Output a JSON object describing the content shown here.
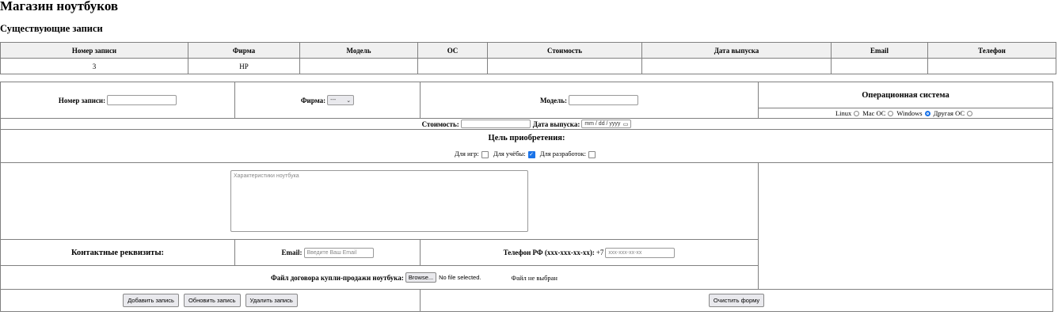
{
  "title": "Магазин ноутбуков",
  "records_heading": "Существующие записи",
  "table": {
    "headers": [
      "Номер записи",
      "Фирма",
      "Модель",
      "ОС",
      "Стоимость",
      "Дата выпуска",
      "Email",
      "Телефон"
    ],
    "rows": [
      [
        "3",
        "HP",
        "",
        "",
        "",
        "",
        "",
        ""
      ]
    ]
  },
  "form": {
    "id_label": "Номер записи:",
    "id_value": "",
    "brand_label": "Фирма:",
    "brand_selected": "---",
    "model_label": "Модель:",
    "model_value": "",
    "os_heading": "Операционная система",
    "os_options": [
      "Linux",
      "Mac OC",
      "Windows",
      "Другая ОС"
    ],
    "os_selected": "Windows",
    "price_label": "Стоимость:",
    "price_value": "",
    "date_label": "Дата выпуска:",
    "date_placeholder": "mm / dd / yyyy",
    "purpose_heading": "Цель приобретения:",
    "purposes": [
      {
        "label": "Для игр:",
        "checked": false
      },
      {
        "label": "Для учёбы:",
        "checked": true
      },
      {
        "label": "Для разработок:",
        "checked": false
      }
    ],
    "specs_placeholder": "Характеристики ноутбука",
    "contacts_heading": "Контактные реквизиты:",
    "email_label": "Email:",
    "email_placeholder": "Введите Ваш Email",
    "phone_label": "Телефон РФ (xxx-xxx-xx-xx):",
    "phone_prefix": "+7",
    "phone_placeholder": "xxx-xxx-xx-xx",
    "file_label": "Файл договора купли-продажи ноутбука:",
    "browse_label": "Browse...",
    "file_status": "No file selected.",
    "file_note": "Файл не выбран",
    "add_label": "Добавить запись",
    "update_label": "Обновить запись",
    "delete_label": "Удалить запись",
    "clear_label": "Очистить форму"
  },
  "colors": {
    "accent": "#1a73e8",
    "header_bg": "#f0f0f0"
  }
}
